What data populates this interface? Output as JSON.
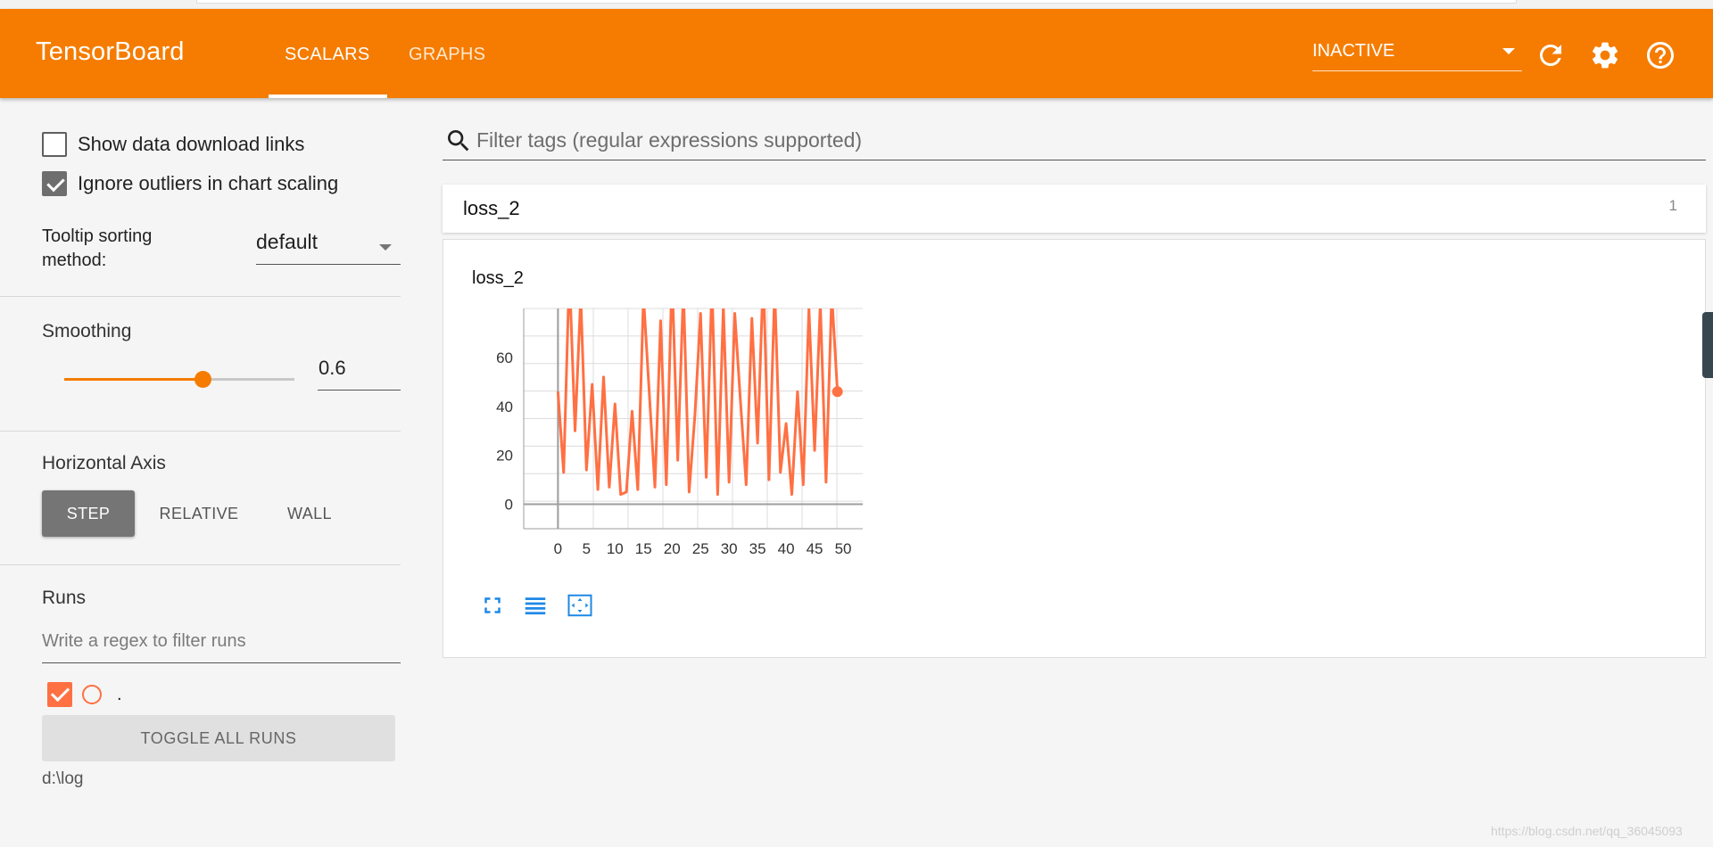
{
  "header": {
    "brand": "TensorBoard",
    "tabs": [
      {
        "label": "SCALARS",
        "active": true
      },
      {
        "label": "GRAPHS",
        "active": false
      }
    ],
    "status_select": "INACTIVE",
    "icons": [
      "refresh-icon",
      "gear-icon",
      "help-icon"
    ],
    "color": "#f57c00"
  },
  "sidebar": {
    "show_download_links": {
      "label": "Show data download links",
      "checked": false
    },
    "ignore_outliers": {
      "label": "Ignore outliers in chart scaling",
      "checked": true
    },
    "tooltip_sorting": {
      "label": "Tooltip sorting method:",
      "value": "default"
    },
    "smoothing": {
      "label": "Smoothing",
      "value": "0.6",
      "level": 0.6
    },
    "horizontal_axis": {
      "label": "Horizontal Axis",
      "options": [
        "STEP",
        "RELATIVE",
        "WALL"
      ],
      "selected": "STEP"
    },
    "runs": {
      "label": "Runs",
      "filter_placeholder": "Write a regex to filter runs",
      "items": [
        {
          "name": ".",
          "checked": true,
          "color": "#ff7043"
        }
      ],
      "toggle_all_label": "TOGGLE ALL RUNS",
      "logdir": "d:\\log"
    }
  },
  "main": {
    "filter_placeholder": "Filter tags (regular expressions supported)",
    "category": {
      "name": "loss_2",
      "count": "1"
    },
    "card_title": "loss_2"
  },
  "watermark": "https://blog.csdn.net/qq_36045093",
  "chart_data": {
    "type": "line",
    "title": "loss_2",
    "xlabel": "",
    "ylabel": "",
    "xlim": [
      -6,
      55
    ],
    "ylim": [
      -10,
      80
    ],
    "x_ticks": [
      0,
      5,
      10,
      15,
      20,
      25,
      30,
      35,
      40,
      45,
      50
    ],
    "y_ticks": [
      0,
      20,
      40,
      60
    ],
    "grid": true,
    "series": [
      {
        "color": "#ff7043",
        "x": [
          0,
          1,
          2,
          3,
          4,
          5,
          6,
          7,
          8,
          9,
          10,
          11,
          12,
          13,
          14,
          15,
          16,
          17,
          18,
          19,
          20,
          21,
          22,
          23,
          24,
          25,
          26,
          27,
          28,
          29,
          30,
          31,
          32,
          33,
          34,
          35,
          36,
          37,
          38,
          39,
          40,
          41,
          42,
          43,
          44,
          45,
          46,
          47,
          48,
          49
        ],
        "values": [
          46,
          13,
          95,
          30,
          85,
          14,
          49,
          6,
          52,
          7,
          41,
          4,
          5,
          38,
          6,
          85,
          46,
          7,
          75,
          8,
          94,
          18,
          88,
          5,
          36,
          78,
          11,
          90,
          4,
          81,
          9,
          78,
          42,
          8,
          76,
          25,
          94,
          10,
          88,
          13,
          33,
          4,
          46,
          8,
          80,
          22,
          82,
          9,
          86,
          46
        ]
      }
    ]
  }
}
